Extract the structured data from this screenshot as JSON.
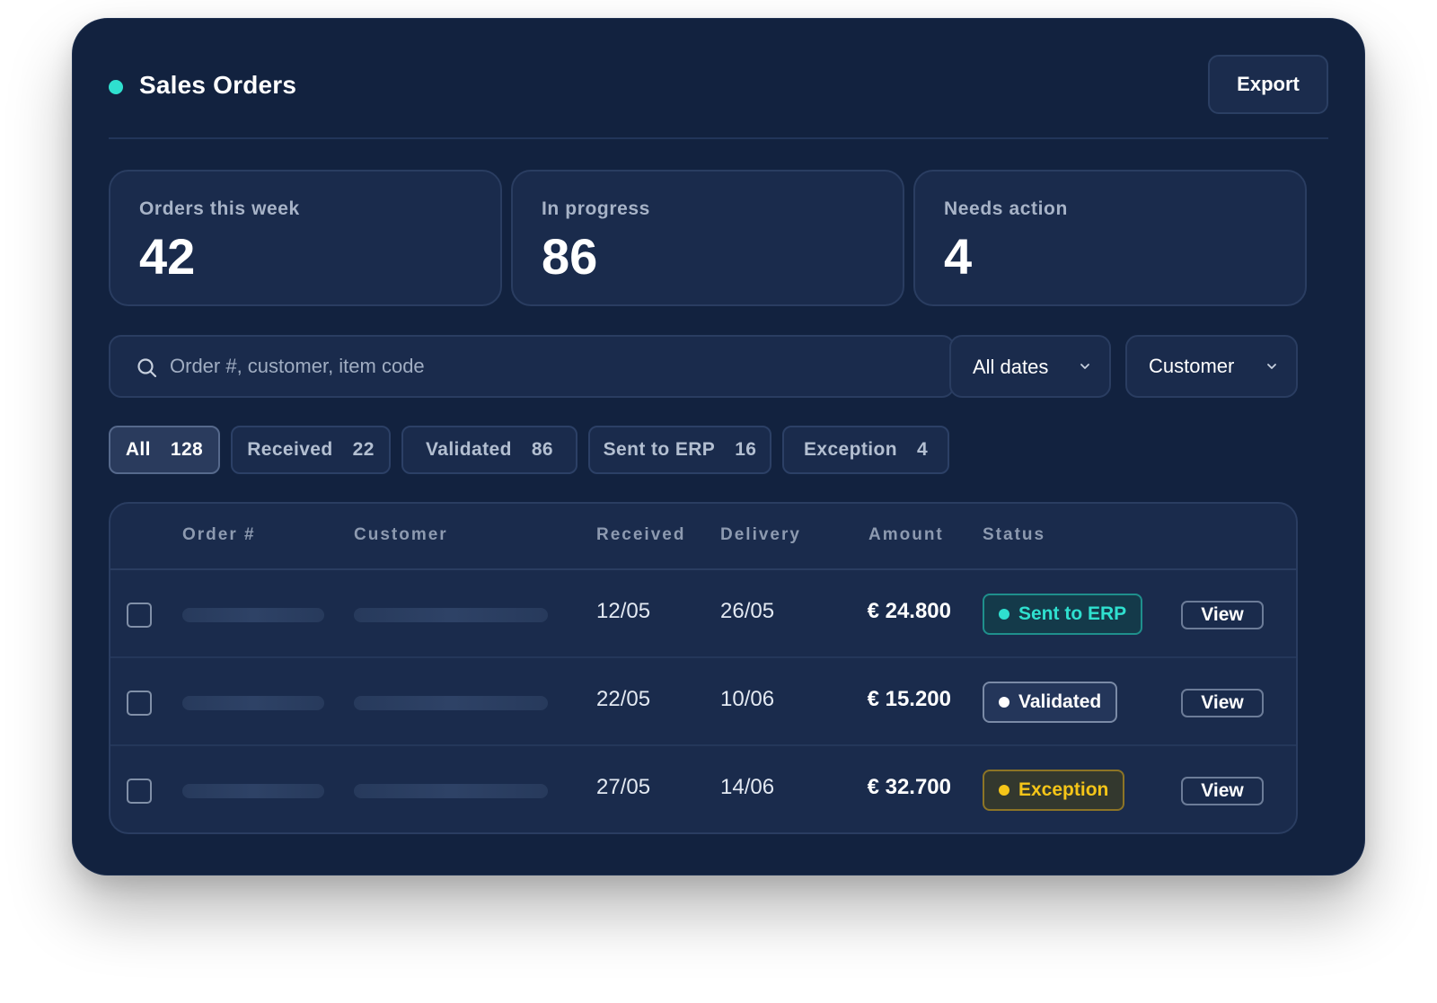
{
  "header": {
    "title": "Sales Orders",
    "status_color": "#2fe0cf",
    "export_label": "Export"
  },
  "stats": [
    {
      "label": "Orders this week",
      "value": "42"
    },
    {
      "label": "In progress",
      "value": "86"
    },
    {
      "label": "Needs action",
      "value": "4"
    }
  ],
  "search": {
    "placeholder": "Order #, customer, item code",
    "icon": "search-icon"
  },
  "filters": {
    "dates": {
      "label": "All dates",
      "icon": "chevron-down-icon"
    },
    "customer": {
      "label": "Customer",
      "icon": "chevron-down-icon"
    }
  },
  "chips": [
    {
      "label": "All",
      "count": "128",
      "active": true
    },
    {
      "label": "Received",
      "count": "22",
      "active": false
    },
    {
      "label": "Validated",
      "count": "86",
      "active": false
    },
    {
      "label": "Sent to ERP",
      "count": "16",
      "active": false
    },
    {
      "label": "Exception",
      "count": "4",
      "active": false
    }
  ],
  "table": {
    "columns": [
      "Order #",
      "Customer",
      "Received",
      "Delivery",
      "Amount",
      "Status"
    ],
    "rows": [
      {
        "received": "12/05",
        "delivery": "26/05",
        "amount": "€ 24.800",
        "status": "Sent to ERP",
        "status_color": "#2fe0cf",
        "action": "View"
      },
      {
        "received": "22/05",
        "delivery": "10/06",
        "amount": "€ 15.200",
        "status": "Validated",
        "status_color": "#ffffff",
        "action": "View"
      },
      {
        "received": "27/05",
        "delivery": "14/06",
        "amount": "€ 32.700",
        "status": "Exception",
        "status_color": "#f5c518",
        "action": "View"
      }
    ]
  }
}
